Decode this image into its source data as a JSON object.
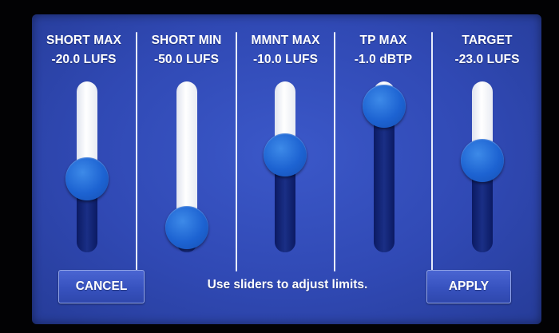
{
  "sliders": [
    {
      "title": "SHORT MAX",
      "value": "-20.0 LUFS",
      "level": 0.4
    },
    {
      "title": "SHORT MIN",
      "value": "-50.0 LUFS",
      "level": 0.0
    },
    {
      "title": "MMNT MAX",
      "value": "-10.0 LUFS",
      "level": 0.6
    },
    {
      "title": "TP MAX",
      "value": "-1.0 dBTP",
      "level": 1.0
    },
    {
      "title": "TARGET",
      "value": "-23.0 LUFS",
      "level": 0.55
    }
  ],
  "footer": {
    "cancel_label": "CANCEL",
    "hint": "Use sliders to adjust limits.",
    "apply_label": "APPLY"
  },
  "colors": {
    "panel": "#3049b4",
    "track_filled": "#ffffff",
    "track_empty": "#15277a",
    "knob": "#1d63d2",
    "text": "#ffffff"
  }
}
